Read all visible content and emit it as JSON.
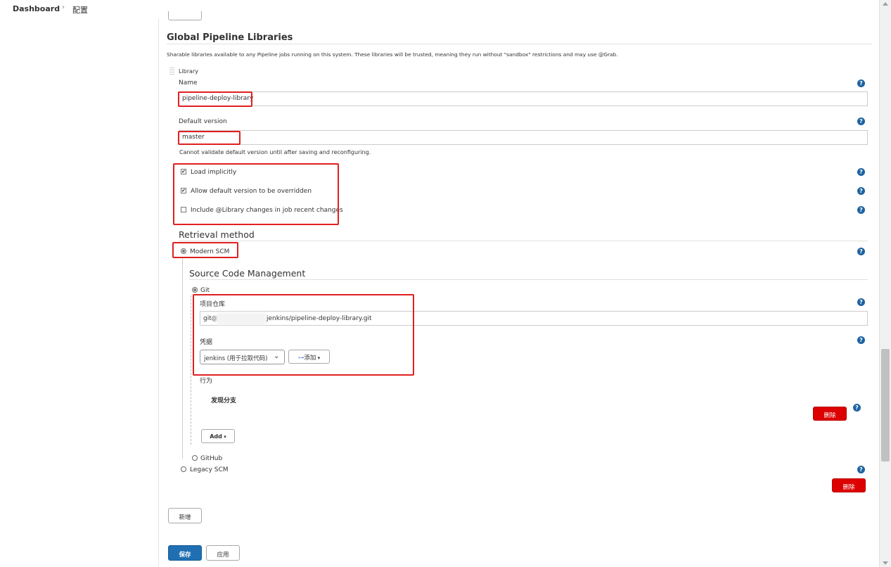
{
  "breadcrumb": {
    "dashboard": "Dashboard",
    "separator": "›",
    "current": "配置"
  },
  "section": {
    "title": "Global Pipeline Libraries",
    "description": "Sharable libraries available to any Pipeline jobs running on this system. These libraries will be trusted, meaning they run without \"sandbox\" restrictions and may use @Grab."
  },
  "library": {
    "header": "Library",
    "name_label": "Name",
    "name_value": "pipeline-deploy-library",
    "default_version_label": "Default version",
    "default_version_value": "master",
    "default_version_note": "Cannot validate default version until after saving and reconfiguring.",
    "load_implicitly": {
      "label": "Load implicitly",
      "checked": "✔"
    },
    "allow_override": {
      "label": "Allow default version to be overridden",
      "checked": "✔"
    },
    "include_changes": {
      "label": "Include @Library changes in job recent changes",
      "checked": ""
    }
  },
  "retrieval": {
    "title": "Retrieval method",
    "modern_scm": "Modern SCM",
    "legacy_scm": "Legacy SCM"
  },
  "scm": {
    "title": "Source Code Management",
    "git": "Git",
    "github": "GitHub",
    "repo_label": "项目仓库",
    "repo_value_prefix": "git@",
    "repo_value_suffix": "jenkins/pipeline-deploy-library.git",
    "credentials_label": "凭据",
    "credentials_value": "jenkins (用于拉取代码)",
    "add_credentials": "添加",
    "behaviors_label": "行为",
    "discover_branches": "发现分支",
    "add_button": "Add",
    "delete_behavior": "删除"
  },
  "buttons": {
    "delete_library": "删除",
    "add_library": "新增",
    "save": "保存",
    "apply": "应用",
    "help": "?"
  },
  "colors": {
    "save_blue": "#1f6fb2",
    "delete_red": "#dd0000",
    "highlight_red": "#e02020",
    "help_blue": "#1f63a0"
  }
}
